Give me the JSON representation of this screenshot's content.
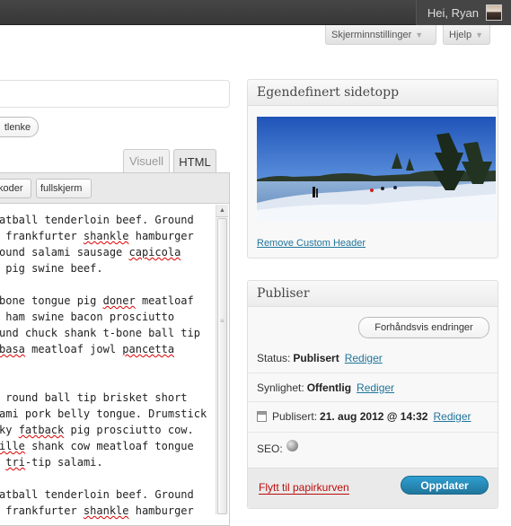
{
  "adminbar": {
    "greeting": "Hei, Ryan"
  },
  "screen_meta": {
    "screen_options": "Skjerminnstillinger",
    "help": "Hjelp"
  },
  "editor": {
    "link_button": "tlenke",
    "tabs": {
      "visual": "Visuell",
      "html": "HTML"
    },
    "quicktags": {
      "code": "koder",
      "fullscreen": "fullskjerm"
    },
    "lines": [
      [
        {
          "t": "atball tenderloin beef. Ground"
        }
      ],
      [
        {
          "t": " frankfurter "
        },
        {
          "t": "shankle",
          "s": true
        },
        {
          "t": " hamburger"
        }
      ],
      [
        {
          "t": "ound salami sausage "
        },
        {
          "t": "capicola",
          "s": true
        }
      ],
      [
        {
          "t": " pig swine beef."
        }
      ],
      [
        {
          "t": ""
        }
      ],
      [
        {
          "t": "bone tongue pig "
        },
        {
          "t": "doner",
          "s": true
        },
        {
          "t": " meatloaf"
        }
      ],
      [
        {
          "t": " ham swine bacon prosciutto"
        }
      ],
      [
        {
          "t": "und chuck shank t-bone ball tip"
        }
      ],
      [
        {
          "t": "basa",
          "s": true
        },
        {
          "t": " meatloaf jowl "
        },
        {
          "t": "pancetta",
          "s": true
        }
      ],
      [
        {
          "t": ""
        }
      ],
      [
        {
          "t": ""
        }
      ],
      [
        {
          "t": " round ball tip brisket short"
        }
      ],
      [
        {
          "t": "ami pork belly tongue. Drumstick"
        }
      ],
      [
        {
          "t": "ky "
        },
        {
          "t": "fatback",
          "s": true
        },
        {
          "t": " pig prosciutto cow."
        }
      ],
      [
        {
          "t": "ille",
          "s": true
        },
        {
          "t": " shank cow meatloaf tongue"
        }
      ],
      [
        {
          "t": " "
        },
        {
          "t": "tri",
          "s": true
        },
        {
          "t": "-tip salami."
        }
      ],
      [
        {
          "t": ""
        }
      ],
      [
        {
          "t": "atball tenderloin beef. Ground"
        }
      ],
      [
        {
          "t": " frankfurter "
        },
        {
          "t": "shankle",
          "s": true
        },
        {
          "t": " hamburger"
        }
      ]
    ]
  },
  "custom_header": {
    "title": "Egendefinert sidetopp",
    "remove_link": "Remove Custom Header"
  },
  "publish": {
    "title": "Publiser",
    "preview_button": "Forhåndsvis endringer",
    "status_label": "Status:",
    "status_value": "Publisert",
    "visibility_label": "Synlighet:",
    "visibility_value": "Offentlig",
    "published_label": "Publisert:",
    "published_value": "21. aug 2012 @ 14:32",
    "edit_link": "Rediger",
    "seo_label": "SEO:",
    "trash_link": "Flytt til papirkurven",
    "update_button": "Oppdater"
  },
  "colors": {
    "link": "#21759b",
    "trash": "#bc0b0b",
    "primary_button": "#21759b"
  }
}
